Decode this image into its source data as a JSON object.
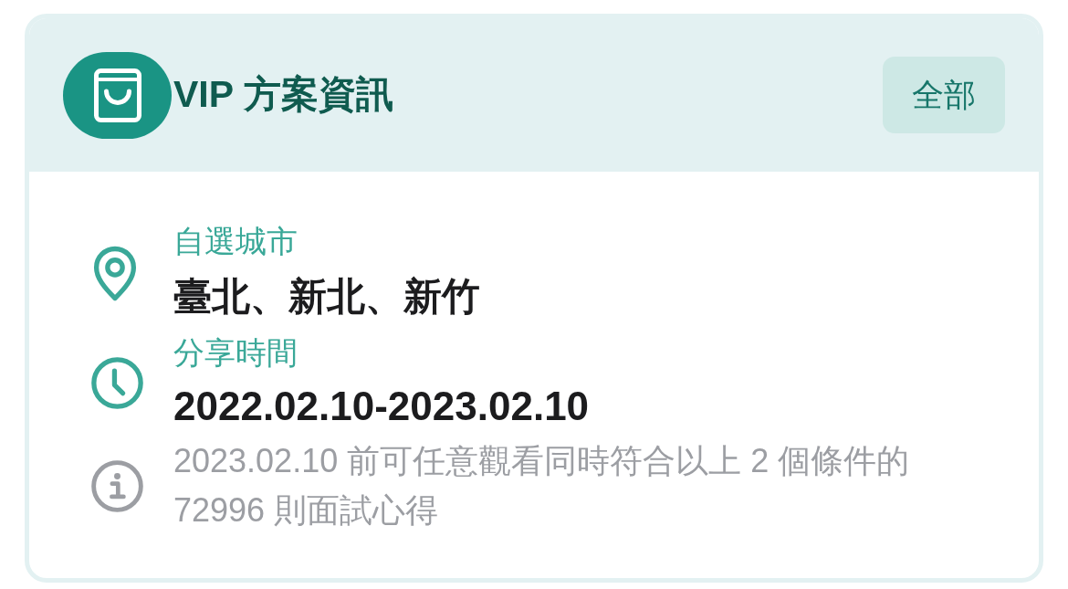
{
  "header": {
    "title": "VIP 方案資訊",
    "button": "全部"
  },
  "details": [
    {
      "kind": "location",
      "label": "自選城市",
      "value": "臺北、新北、新竹"
    },
    {
      "kind": "time",
      "label": "分享時間",
      "value": "2022.02.10-2023.02.10"
    },
    {
      "kind": "info",
      "note": "2023.02.10 前可任意觀看同時符合以上 2 個條件的 72996 則面試心得"
    }
  ]
}
